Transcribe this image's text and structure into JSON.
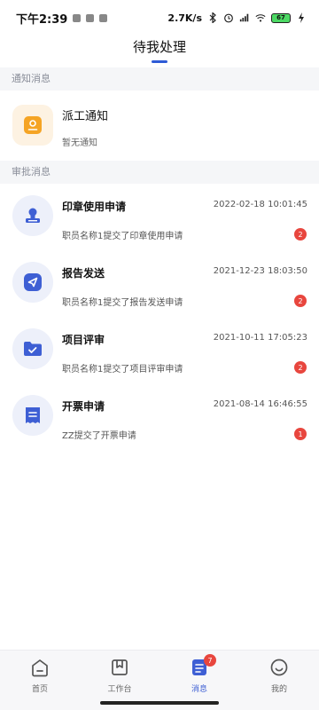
{
  "status_bar": {
    "time": "下午2:39",
    "net_speed": "2.7K/s",
    "battery": "67"
  },
  "header": {
    "title": "待我处理"
  },
  "sections": {
    "notice": "通知消息",
    "approval": "审批消息"
  },
  "notice_item": {
    "title": "派工通知",
    "subtitle": "暂无通知",
    "icon": "document-icon",
    "color": "#f5a424"
  },
  "approvals": [
    {
      "title": "印章使用申请",
      "time": "2022-02-18 10:01:45",
      "desc": "职员名称1提交了印章使用申请",
      "badge": "2",
      "icon": "stamp-icon"
    },
    {
      "title": "报告发送",
      "time": "2021-12-23 18:03:50",
      "desc": "职员名称1提交了报告发送申请",
      "badge": "2",
      "icon": "send-icon"
    },
    {
      "title": "项目评审",
      "time": "2021-10-11 17:05:23",
      "desc": "职员名称1提交了项目评审申请",
      "badge": "2",
      "icon": "folder-check-icon"
    },
    {
      "title": "开票申请",
      "time": "2021-08-14 16:46:55",
      "desc": "ZZ提交了开票申请",
      "badge": "1",
      "icon": "invoice-icon"
    }
  ],
  "bottom_nav": {
    "tabs": [
      {
        "label": "首页",
        "icon": "home-icon"
      },
      {
        "label": "工作台",
        "icon": "workbench-icon"
      },
      {
        "label": "消息",
        "icon": "message-icon",
        "badge": "7",
        "active": true
      },
      {
        "label": "我的",
        "icon": "smile-icon"
      }
    ]
  },
  "colors": {
    "accent": "#3e5fd4",
    "badge": "#e8463e",
    "section_bg": "#f5f6f8"
  }
}
